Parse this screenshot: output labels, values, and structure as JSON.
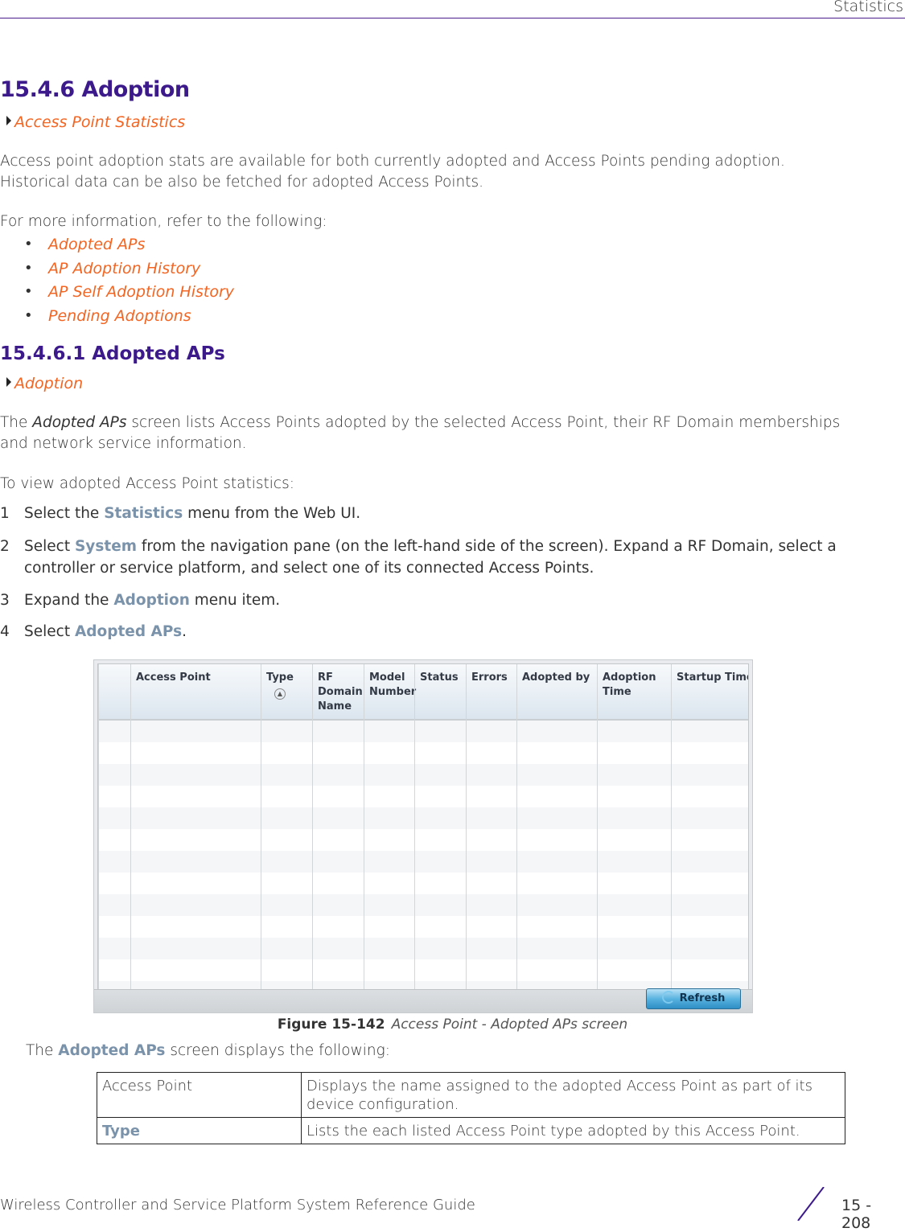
{
  "header": {
    "section_title": "Statistics"
  },
  "section": {
    "heading": "15.4.6 Adoption",
    "breadcrumb": "Access Point Statistics",
    "intro_lines": [
      "Access point adoption stats are available for both currently adopted and Access Points pending adoption.",
      "Historical data can be also be fetched for adopted Access Points."
    ],
    "refer_text": "For more information, refer to the following:",
    "links": [
      "Adopted APs",
      "AP Adoption History",
      "AP Self Adoption History",
      "Pending Adoptions"
    ],
    "bullet_glyph": "•"
  },
  "subsection": {
    "heading": "15.4.6.1  Adopted APs",
    "breadcrumb": "Adoption",
    "desc_prefix": "The ",
    "desc_em": "Adopted APs",
    "desc_line1_rest": " screen lists Access Points adopted by the selected Access Point, their RF Domain memberships",
    "desc_line2": "and network service information.",
    "steps_intro": "To view adopted Access Point statistics:",
    "steps": [
      {
        "num": "1",
        "pre": "Select the ",
        "ui": "Statistics",
        "post": " menu from the Web UI.",
        "post2": ""
      },
      {
        "num": "2",
        "pre": "Select ",
        "ui": "System",
        "post": " from the navigation pane (on the left-hand side of the screen). Expand a RF Domain, select a",
        "post2": "controller or service platform, and select one of its connected Access Points."
      },
      {
        "num": "3",
        "pre": "Expand the ",
        "ui": "Adoption",
        "post": " menu item.",
        "post2": ""
      },
      {
        "num": "4",
        "pre": "Select ",
        "ui": "Adopted APs",
        "post": ".",
        "post2": ""
      }
    ]
  },
  "figure": {
    "columns": [
      "",
      "Access Point",
      "Type",
      "RF\nDomain\nName",
      "Model\nNumber",
      "Status",
      "Errors",
      "Adopted by",
      "Adoption\nTime",
      "Startup Time"
    ],
    "sort_icon": "▲",
    "refresh_label": "Refresh",
    "caption_label": "Figure 15-142",
    "caption_text": "Access Point - Adopted APs screen"
  },
  "displays_intro": {
    "pre": "The ",
    "ui": "Adopted APs",
    "post": " screen displays the following:"
  },
  "desc_table": [
    {
      "field": "Access Point",
      "field_ui": false,
      "description": "Displays the name assigned to the adopted Access Point as part of its device configuration."
    },
    {
      "field": "Type",
      "field_ui": true,
      "description": "Lists the each listed Access Point type adopted by this Access Point."
    }
  ],
  "footer": {
    "guide_title": "Wireless Controller and Service Platform System Reference Guide",
    "page_number": "15 - 208"
  }
}
